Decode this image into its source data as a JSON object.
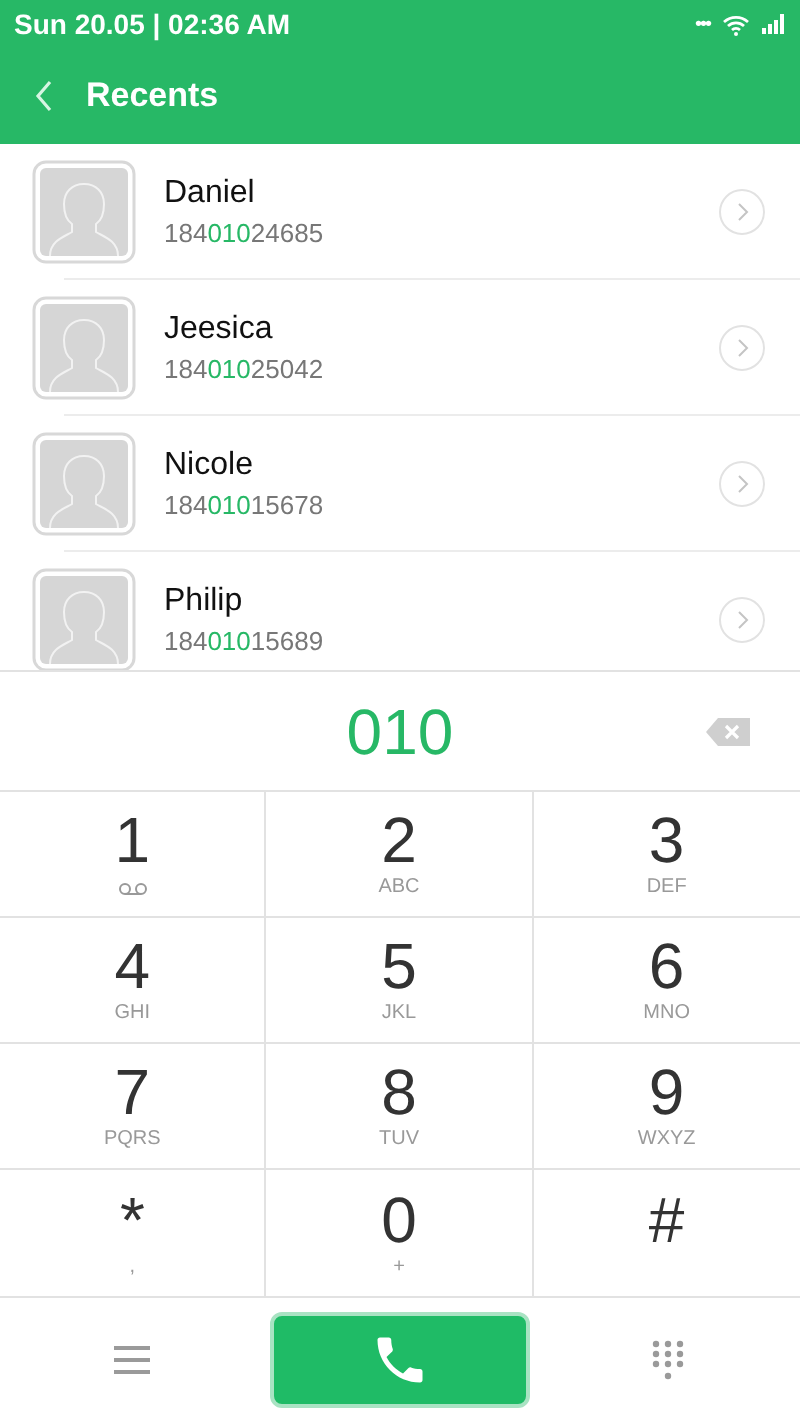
{
  "status_bar": {
    "time": "Sun 20.05 | 02:36 AM",
    "dots": "•••"
  },
  "header": {
    "title": "Recents"
  },
  "contacts": [
    {
      "name": "Daniel",
      "number": {
        "prefix": "184",
        "match": "010",
        "suffix": "24685"
      }
    },
    {
      "name": "Jeesica",
      "number": {
        "prefix": "184",
        "match": "010",
        "suffix": "25042"
      }
    },
    {
      "name": "Nicole",
      "number": {
        "prefix": "184",
        "match": "010",
        "suffix": "15678"
      }
    },
    {
      "name": "Philip",
      "number": {
        "prefix": "184",
        "match": "010",
        "suffix": "15689"
      }
    }
  ],
  "dialed": "010",
  "keypad": [
    {
      "digit": "1",
      "kind": "voicemail"
    },
    {
      "digit": "2",
      "letters": "ABC"
    },
    {
      "digit": "3",
      "letters": "DEF"
    },
    {
      "digit": "4",
      "letters": "GHI"
    },
    {
      "digit": "5",
      "letters": "JKL"
    },
    {
      "digit": "6",
      "letters": "MNO"
    },
    {
      "digit": "7",
      "letters": "PQRS"
    },
    {
      "digit": "8",
      "letters": "TUV"
    },
    {
      "digit": "9",
      "letters": "WXYZ"
    },
    {
      "digit": "*",
      "letters": ","
    },
    {
      "digit": "0",
      "letters": "+"
    },
    {
      "digit": "#"
    }
  ]
}
